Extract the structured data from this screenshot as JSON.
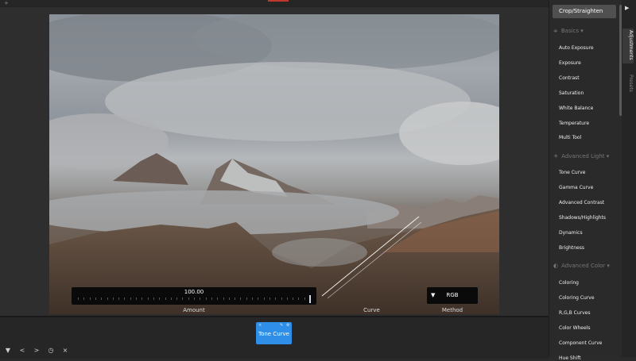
{
  "top": {
    "add_label": "+"
  },
  "hud": {
    "amount_value": "100.00",
    "amount_label": "Amount",
    "curve_label": "Curve",
    "method_value": "RGB",
    "method_label": "Method",
    "amount_level": 1.0
  },
  "tool_tile": {
    "label": "Tone Curve"
  },
  "bottom_controls": [
    "▼",
    "<",
    ">",
    "◷",
    "×"
  ],
  "panel": {
    "crop_button": "Crop/Straighten",
    "sections": [
      {
        "title": "Basics",
        "icon": "sliders-icon"
      },
      {
        "title": "Advanced Light",
        "icon": "sun-icon"
      },
      {
        "title": "Advanced Color",
        "icon": "color-circle-icon"
      }
    ],
    "basics": [
      "Auto Exposure",
      "Exposure",
      "Contrast",
      "Saturation",
      "White Balance",
      "Temperature",
      "Multi Tool"
    ],
    "advanced_light": [
      "Tone Curve",
      "Gamma Curve",
      "Advanced Contrast",
      "Shadows/Highlights",
      "Dynamics",
      "Brightness"
    ],
    "advanced_color": [
      "Coloring",
      "Coloring Curve",
      "R,G,B Curves",
      "Color Wheels",
      "Component Curve",
      "Hue Shift"
    ]
  },
  "vtabs": {
    "adjustments": "Adjustments",
    "presets": "Presets"
  },
  "colors": {
    "accent": "#2f8fe8",
    "panel_bg": "#2a2a2a",
    "hud_bg": "#0a0a0a"
  }
}
